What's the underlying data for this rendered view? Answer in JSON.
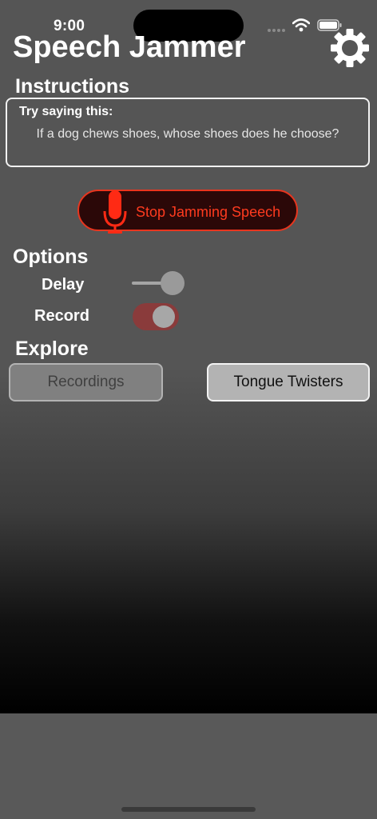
{
  "status_bar": {
    "time": "9:00"
  },
  "header": {
    "title": "Speech Jammer",
    "settings_icon": "gear-icon"
  },
  "instructions": {
    "heading": "Instructions",
    "try_label": "Try saying this:",
    "prompt": "If a dog chews shoes, whose shoes does he choose?"
  },
  "jam_button": {
    "label": "Stop Jamming Speech",
    "icon": "microphone-icon",
    "color": "#ff3b1f"
  },
  "options": {
    "heading": "Options",
    "delay_label": "Delay",
    "delay_value": 0.78,
    "record_label": "Record",
    "record_on": true
  },
  "explore": {
    "heading": "Explore",
    "recordings_label": "Recordings",
    "recordings_enabled": false,
    "tongue_twisters_label": "Tongue Twisters"
  }
}
